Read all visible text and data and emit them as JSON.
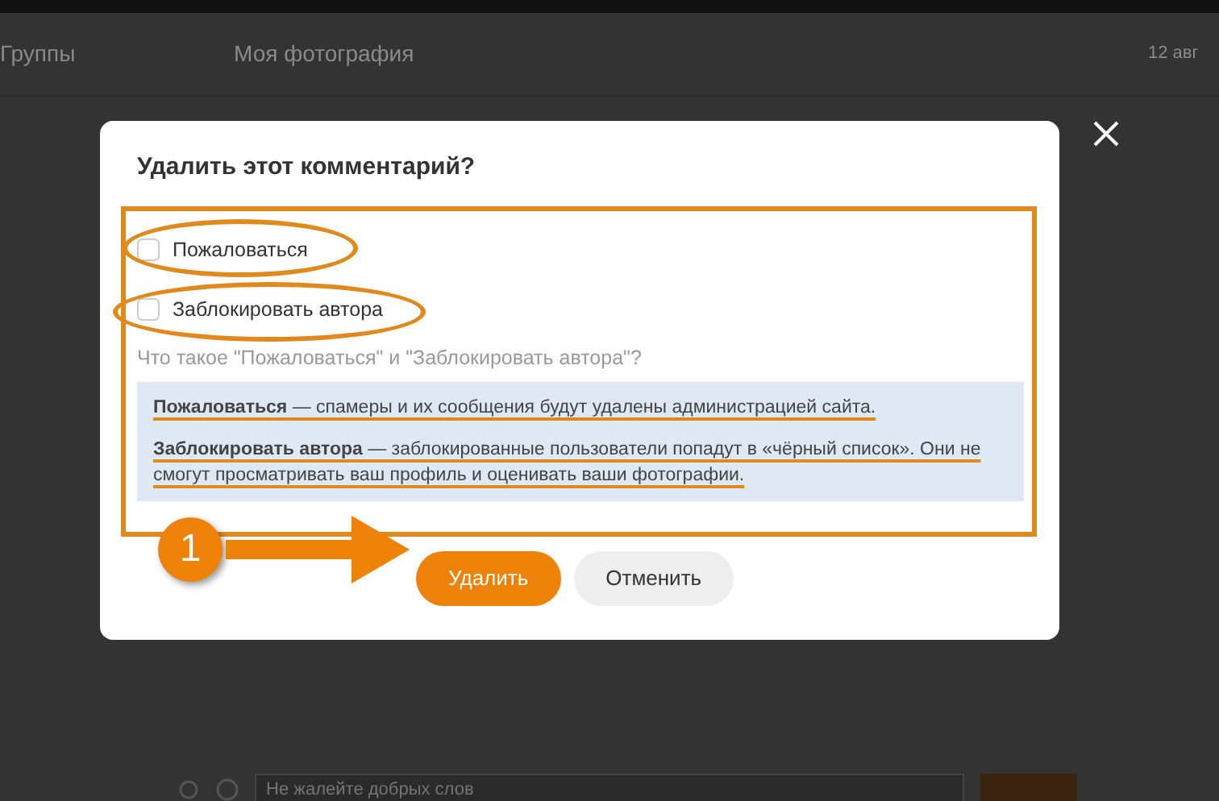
{
  "page": {
    "nav_item": "Группы",
    "photo_title": "Моя фотография",
    "date": "12 авг",
    "comment_placeholder": "Не жалейте добрых слов"
  },
  "dialog": {
    "title": "Удалить этот комментарий?",
    "options": [
      {
        "label": "Пожаловаться",
        "checked": false
      },
      {
        "label": "Заблокировать автора",
        "checked": false
      }
    ],
    "help_link": "Что такое \"Пожаловаться\" и \"Заблокировать автора\"?",
    "info": [
      "**Пожаловаться** — спамеры и их сообщения будут удалены администрацией сайта.",
      "**Заблокировать автора** — заблокированные пользователи попадут в «чёрный список». Они не смогут просматривать ваш профиль и оценивать ваши фотографии."
    ],
    "buttons": [
      {
        "label": "Удалить",
        "kind": "primary"
      },
      {
        "label": "Отменить",
        "kind": "secondary"
      }
    ]
  },
  "annotation": {
    "step": "1"
  }
}
